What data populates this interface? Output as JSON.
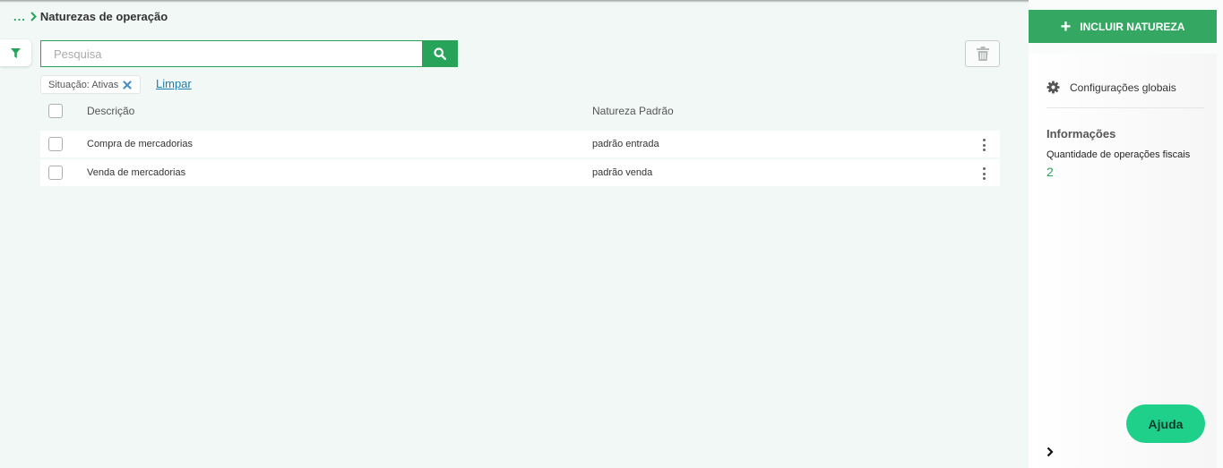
{
  "breadcrumb": {
    "ellipsis": "...",
    "title": "Naturezas de operação"
  },
  "toolbar": {
    "search_placeholder": "Pesquisa",
    "search_value": "",
    "filter_icon": "filter-icon",
    "search_icon": "search-icon",
    "delete_icon": "trash-icon"
  },
  "filters": {
    "chip_label": "Situação: Ativas",
    "chip_remove_icon": "close-icon",
    "clear_label": "Limpar"
  },
  "table": {
    "columns": [
      "Descrição",
      "Natureza Padrão"
    ],
    "rows": [
      {
        "descricao": "Compra de mercadorias",
        "natureza": "padrão entrada"
      },
      {
        "descricao": "Venda de mercadorias",
        "natureza": "padrão venda"
      }
    ]
  },
  "sidebar": {
    "add_button": "INCLUIR NATUREZA",
    "add_icon": "plus-icon",
    "config_label": "Configurações globais",
    "config_icon": "gear-icon",
    "info_title": "Informações",
    "info_label": "Quantidade de operações fiscais",
    "info_value": "2",
    "help_button": "Ajuda",
    "collapse_icon": "chevron-right-icon"
  },
  "colors": {
    "primary": "#27a35a",
    "help": "#1fd08a",
    "link": "#1c7fb0",
    "background": "#f1f8f5"
  }
}
